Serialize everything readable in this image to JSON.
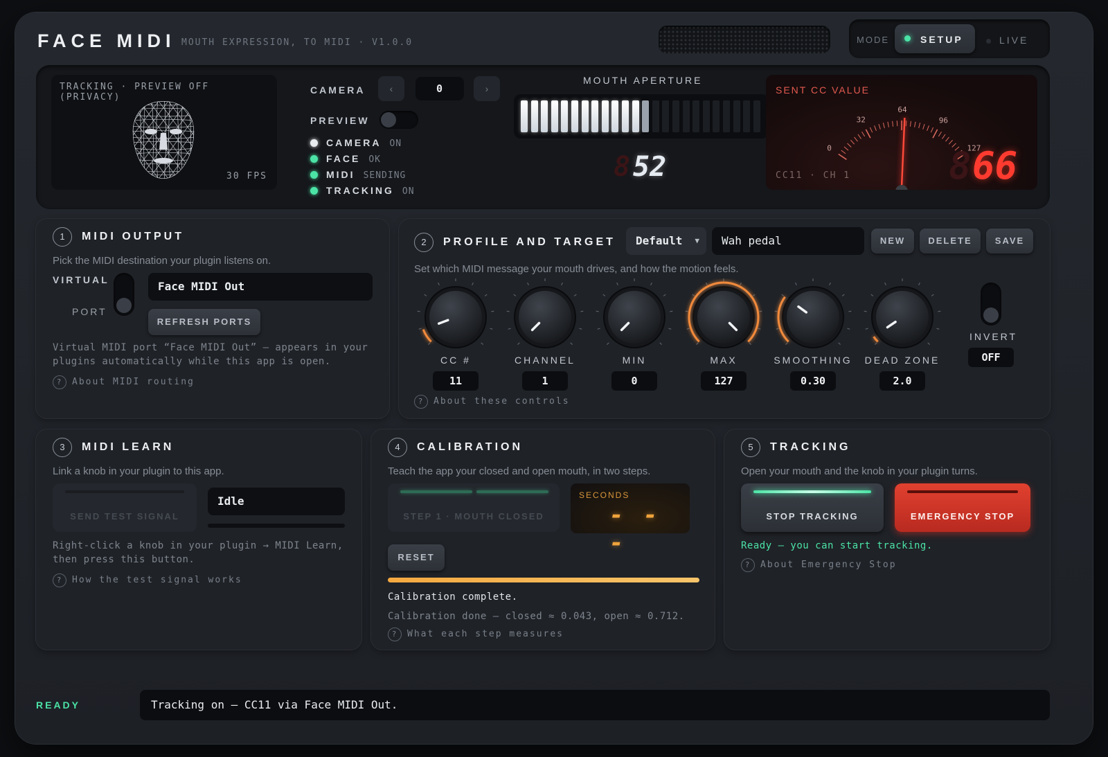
{
  "header": {
    "title": "FACE MIDI",
    "subtitle": "MOUTH EXPRESSION, TO MIDI · V1.0.0",
    "mode_label": "MODE",
    "mode_setup": "SETUP",
    "mode_live": "LIVE"
  },
  "tracking": {
    "caption": "TRACKING · PREVIEW OFF (PRIVACY)",
    "fps": "30 FPS"
  },
  "camera": {
    "label": "CAMERA",
    "prev": "‹",
    "value": "0",
    "next": "›",
    "preview_label": "PREVIEW",
    "preview_on": false
  },
  "status": [
    {
      "name": "CAMERA",
      "value": "ON",
      "color": "#e9ecef"
    },
    {
      "name": "FACE",
      "value": "OK",
      "color": "#4be3a6"
    },
    {
      "name": "MIDI",
      "value": "SENDING",
      "color": "#4be3a6"
    },
    {
      "name": "TRACKING",
      "value": "ON",
      "color": "#4be3a6"
    }
  ],
  "aperture": {
    "title": "MOUTH APERTURE",
    "value": "52",
    "ghost": "8",
    "level": 0.55
  },
  "cc_meter": {
    "title": "SENT CC VALUE",
    "sub": "CC11 · CH 1",
    "value": "66",
    "ghost": "8",
    "ticks": {
      "t0": "0",
      "t32": "32",
      "t64": "64",
      "t96": "96",
      "t127": "127"
    },
    "current": 66,
    "max": 127
  },
  "midi_output": {
    "num": "1",
    "title": "MIDI OUTPUT",
    "desc": "Pick the MIDI destination your plugin listens on.",
    "virtual": "VIRTUAL",
    "port": "PORT",
    "field": "Face MIDI Out",
    "refresh": "REFRESH PORTS",
    "note1": "Virtual MIDI port “Face MIDI Out” — appears in your",
    "note2": "plugins automatically while this app is open.",
    "help": "About MIDI routing"
  },
  "profile": {
    "num": "2",
    "title": "PROFILE AND TARGET",
    "dropdown": "Default",
    "name": "Wah pedal",
    "new": "NEW",
    "delete": "DELETE",
    "save": "SAVE",
    "desc": "Set which MIDI message your mouth drives, and how the motion feels.",
    "help": "About these controls",
    "invert_label": "INVERT",
    "invert_value": "OFF",
    "knobs": [
      {
        "label": "CC #",
        "value": "11",
        "fraction": 0.09,
        "active": false
      },
      {
        "label": "CHANNEL",
        "value": "1",
        "fraction": 0.0,
        "active": false
      },
      {
        "label": "MIN",
        "value": "0",
        "fraction": 0.0,
        "active": false
      },
      {
        "label": "MAX",
        "value": "127",
        "fraction": 1.0,
        "active": true
      },
      {
        "label": "SMOOTHING",
        "value": "0.30",
        "fraction": 0.3,
        "active": true
      },
      {
        "label": "DEAD ZONE",
        "value": "2.0",
        "fraction": 0.04,
        "active": false
      }
    ]
  },
  "midi_learn": {
    "num": "3",
    "title": "MIDI LEARN",
    "desc": "Link a knob in your plugin to this app.",
    "send": "SEND TEST SIGNAL",
    "state": "Idle",
    "note1": "Right-click a knob in your plugin → MIDI Learn,",
    "note2": "then press this button.",
    "help": "How the test signal works"
  },
  "calibration": {
    "num": "4",
    "title": "CALIBRATION",
    "desc": "Teach the app your closed and open mouth, in two steps.",
    "step": "STEP 1 · MOUTH CLOSED",
    "seconds_label": "SECONDS",
    "seconds": "- - -",
    "reset": "RESET",
    "progress": 1.0,
    "done": "Calibration complete.",
    "detail": "Calibration done — closed ≈ 0.043, open ≈ 0.712.",
    "help": "What each step measures"
  },
  "tracking_panel": {
    "num": "5",
    "title": "TRACKING",
    "desc": "Open your mouth and the knob in your plugin turns.",
    "stop": "STOP TRACKING",
    "emergency": "EMERGENCY STOP",
    "ready_msg": "Ready — you can start tracking.",
    "help": "About Emergency Stop"
  },
  "footer": {
    "state": "READY",
    "message": "Tracking on — CC11 via Face MIDI Out."
  },
  "colors": {
    "accent": "#f08a3c",
    "green": "#4be3a6",
    "red": "#e83a2e"
  }
}
